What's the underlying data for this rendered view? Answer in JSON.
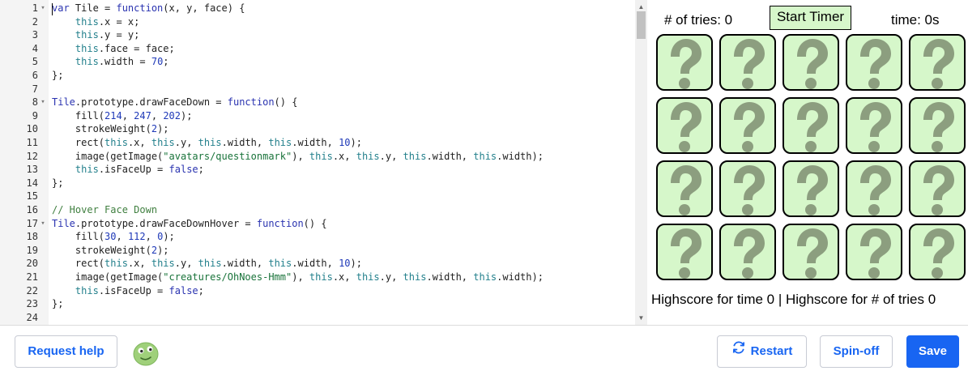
{
  "editor": {
    "lines": [
      {
        "n": "1",
        "fold": "▾",
        "tokens": [
          [
            "kw",
            "var"
          ],
          [
            "p",
            " Tile = "
          ],
          [
            "kw",
            "function"
          ],
          [
            "p",
            "(x, y, face) {"
          ]
        ]
      },
      {
        "n": "2",
        "fold": "",
        "tokens": [
          [
            "p",
            "    "
          ],
          [
            "this",
            "this"
          ],
          [
            "p",
            ".x = x;"
          ]
        ]
      },
      {
        "n": "3",
        "fold": "",
        "tokens": [
          [
            "p",
            "    "
          ],
          [
            "this",
            "this"
          ],
          [
            "p",
            ".y = y;"
          ]
        ]
      },
      {
        "n": "4",
        "fold": "",
        "tokens": [
          [
            "p",
            "    "
          ],
          [
            "this",
            "this"
          ],
          [
            "p",
            ".face = face;"
          ]
        ]
      },
      {
        "n": "5",
        "fold": "",
        "tokens": [
          [
            "p",
            "    "
          ],
          [
            "this",
            "this"
          ],
          [
            "p",
            ".width = "
          ],
          [
            "num",
            "70"
          ],
          [
            "p",
            ";"
          ]
        ]
      },
      {
        "n": "6",
        "fold": "",
        "tokens": [
          [
            "p",
            "};"
          ]
        ]
      },
      {
        "n": "7",
        "fold": "",
        "tokens": []
      },
      {
        "n": "8",
        "fold": "▾",
        "tokens": [
          [
            "kw",
            "Tile"
          ],
          [
            "p",
            ".prototype.drawFaceDown = "
          ],
          [
            "kw",
            "function"
          ],
          [
            "p",
            "() {"
          ]
        ]
      },
      {
        "n": "9",
        "fold": "",
        "tokens": [
          [
            "p",
            "    fill("
          ],
          [
            "num",
            "214"
          ],
          [
            "p",
            ", "
          ],
          [
            "num",
            "247"
          ],
          [
            "p",
            ", "
          ],
          [
            "num",
            "202"
          ],
          [
            "p",
            ");"
          ]
        ]
      },
      {
        "n": "10",
        "fold": "",
        "tokens": [
          [
            "p",
            "    strokeWeight("
          ],
          [
            "num",
            "2"
          ],
          [
            "p",
            ");"
          ]
        ]
      },
      {
        "n": "11",
        "fold": "",
        "tokens": [
          [
            "p",
            "    rect("
          ],
          [
            "this",
            "this"
          ],
          [
            "p",
            ".x, "
          ],
          [
            "this",
            "this"
          ],
          [
            "p",
            ".y, "
          ],
          [
            "this",
            "this"
          ],
          [
            "p",
            ".width, "
          ],
          [
            "this",
            "this"
          ],
          [
            "p",
            ".width, "
          ],
          [
            "num",
            "10"
          ],
          [
            "p",
            ");"
          ]
        ]
      },
      {
        "n": "12",
        "fold": "",
        "tokens": [
          [
            "p",
            "    image(getImage("
          ],
          [
            "str",
            "\"avatars/questionmark\""
          ],
          [
            "p",
            "), "
          ],
          [
            "this",
            "this"
          ],
          [
            "p",
            ".x, "
          ],
          [
            "this",
            "this"
          ],
          [
            "p",
            ".y, "
          ],
          [
            "this",
            "this"
          ],
          [
            "p",
            ".width, "
          ],
          [
            "this",
            "this"
          ],
          [
            "p",
            ".width);"
          ]
        ]
      },
      {
        "n": "13",
        "fold": "",
        "tokens": [
          [
            "p",
            "    "
          ],
          [
            "this",
            "this"
          ],
          [
            "p",
            ".isFaceUp = "
          ],
          [
            "kw",
            "false"
          ],
          [
            "p",
            ";"
          ]
        ]
      },
      {
        "n": "14",
        "fold": "",
        "tokens": [
          [
            "p",
            "};"
          ]
        ]
      },
      {
        "n": "15",
        "fold": "",
        "tokens": []
      },
      {
        "n": "16",
        "fold": "",
        "tokens": [
          [
            "cm",
            "// Hover Face Down"
          ]
        ]
      },
      {
        "n": "17",
        "fold": "▾",
        "tokens": [
          [
            "kw",
            "Tile"
          ],
          [
            "p",
            ".prototype.drawFaceDownHover = "
          ],
          [
            "kw",
            "function"
          ],
          [
            "p",
            "() {"
          ]
        ]
      },
      {
        "n": "18",
        "fold": "",
        "tokens": [
          [
            "p",
            "    fill("
          ],
          [
            "num",
            "30"
          ],
          [
            "p",
            ", "
          ],
          [
            "num",
            "112"
          ],
          [
            "p",
            ", "
          ],
          [
            "num",
            "0"
          ],
          [
            "p",
            ");"
          ]
        ]
      },
      {
        "n": "19",
        "fold": "",
        "tokens": [
          [
            "p",
            "    strokeWeight("
          ],
          [
            "num",
            "2"
          ],
          [
            "p",
            ");"
          ]
        ]
      },
      {
        "n": "20",
        "fold": "",
        "tokens": [
          [
            "p",
            "    rect("
          ],
          [
            "this",
            "this"
          ],
          [
            "p",
            ".x, "
          ],
          [
            "this",
            "this"
          ],
          [
            "p",
            ".y, "
          ],
          [
            "this",
            "this"
          ],
          [
            "p",
            ".width, "
          ],
          [
            "this",
            "this"
          ],
          [
            "p",
            ".width, "
          ],
          [
            "num",
            "10"
          ],
          [
            "p",
            ");"
          ]
        ]
      },
      {
        "n": "21",
        "fold": "",
        "tokens": [
          [
            "p",
            "    image(getImage("
          ],
          [
            "str",
            "\"creatures/OhNoes-Hmm\""
          ],
          [
            "p",
            "), "
          ],
          [
            "this",
            "this"
          ],
          [
            "p",
            ".x, "
          ],
          [
            "this",
            "this"
          ],
          [
            "p",
            ".y, "
          ],
          [
            "this",
            "this"
          ],
          [
            "p",
            ".width, "
          ],
          [
            "this",
            "this"
          ],
          [
            "p",
            ".width);"
          ]
        ]
      },
      {
        "n": "22",
        "fold": "",
        "tokens": [
          [
            "p",
            "    "
          ],
          [
            "this",
            "this"
          ],
          [
            "p",
            ".isFaceUp = "
          ],
          [
            "kw",
            "false"
          ],
          [
            "p",
            ";"
          ]
        ]
      },
      {
        "n": "23",
        "fold": "",
        "tokens": [
          [
            "p",
            "};"
          ]
        ]
      },
      {
        "n": "24",
        "fold": "",
        "tokens": []
      }
    ]
  },
  "game": {
    "tries_label": "# of tries: 0",
    "start_timer_label": "Start Timer",
    "time_label": "time: 0s",
    "tile_rows": 4,
    "tile_cols": 5,
    "tile_icon": "questionmark-icon",
    "tile_fill": "#d6f7ca",
    "highscore_text": "Highscore for time 0 | Highscore for # of tries 0"
  },
  "toolbar": {
    "request_help_label": "Request help",
    "restart_label": "Restart",
    "spinoff_label": "Spin-off",
    "save_label": "Save",
    "restart_icon": "refresh-icon",
    "avatar_icon": "avatar-icon"
  },
  "colors": {
    "primary": "#1865f2",
    "keyword": "#2a33b0",
    "this": "#23808c",
    "string": "#19733a"
  }
}
